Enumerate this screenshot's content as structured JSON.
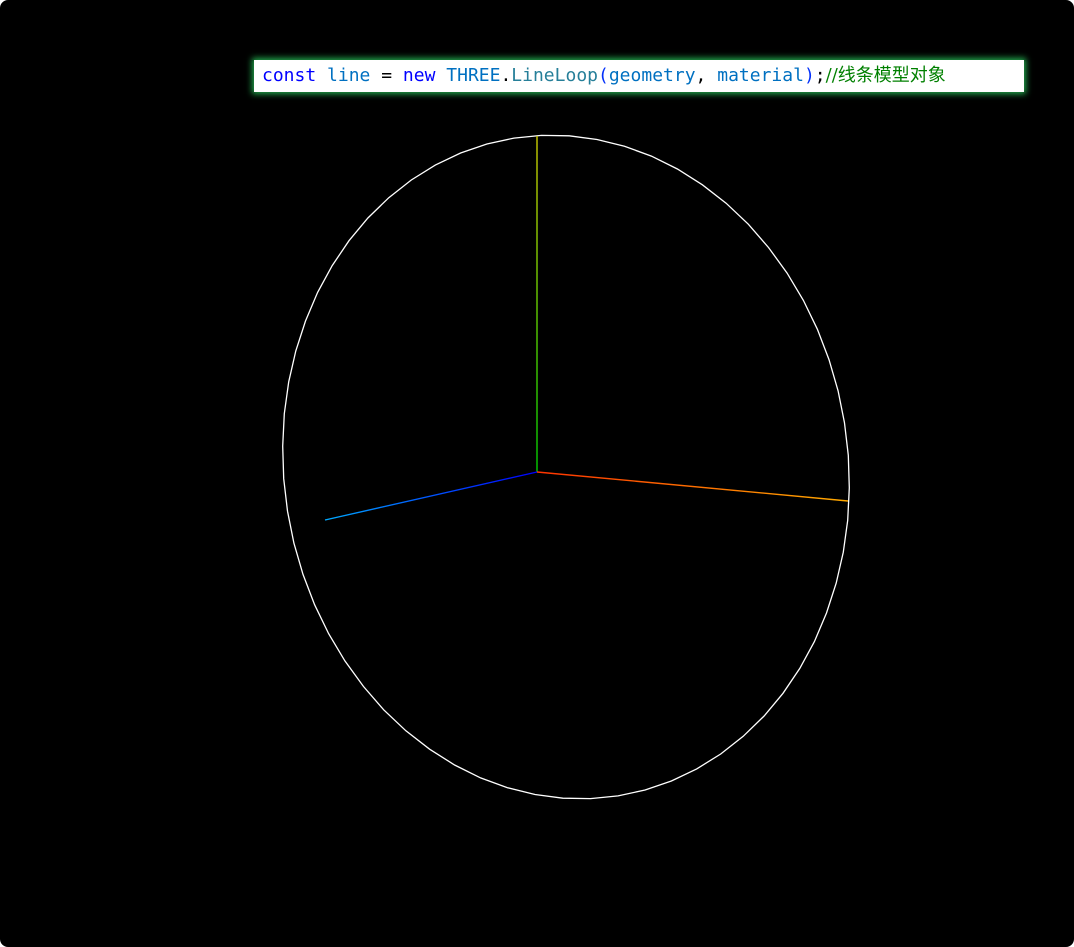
{
  "code_line": {
    "tokens": [
      {
        "text": "const",
        "color": "#0000ff"
      },
      {
        "text": " ",
        "color": "#000000"
      },
      {
        "text": "line",
        "color": "#0070c1"
      },
      {
        "text": " = ",
        "color": "#000000"
      },
      {
        "text": "new",
        "color": "#0000ff"
      },
      {
        "text": " ",
        "color": "#000000"
      },
      {
        "text": "THREE",
        "color": "#0070c1"
      },
      {
        "text": ".",
        "color": "#000000"
      },
      {
        "text": "LineLoop",
        "color": "#267f99"
      },
      {
        "text": "(",
        "color": "#0431fa"
      },
      {
        "text": "geometry",
        "color": "#0070c1"
      },
      {
        "text": ", ",
        "color": "#000000"
      },
      {
        "text": "material",
        "color": "#0070c1"
      },
      {
        "text": ")",
        "color": "#0431fa"
      },
      {
        "text": ";",
        "color": "#000000"
      },
      {
        "text": "//线条模型对象",
        "color": "#008000",
        "comment": true
      }
    ]
  },
  "scene": {
    "background": "#000000",
    "loop_color": "#ffffff",
    "axes": {
      "y": {
        "name": "y-axis",
        "colors": [
          "#00cc00",
          "#cccc00"
        ]
      },
      "x": {
        "name": "x-axis",
        "colors": [
          "#ff3300",
          "#ffaa00"
        ]
      },
      "z": {
        "name": "z-axis",
        "colors": [
          "#0000ff",
          "#00aaff"
        ]
      }
    }
  }
}
